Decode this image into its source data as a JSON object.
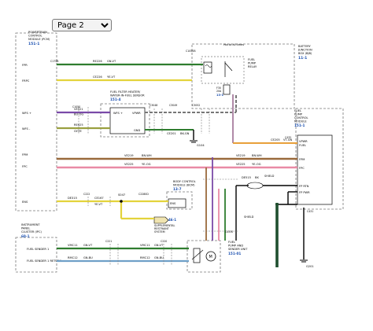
{
  "toolbar": {
    "page_select": {
      "options": [
        "Page 2"
      ],
      "selected": "Page 2"
    }
  },
  "diagram": {
    "pcm": {
      "title_lines": [
        "POWERTRAIN",
        "CONTROL",
        "MODULE (PCM)"
      ],
      "ref": "151-1"
    },
    "bjb": {
      "title_lines": [
        "BATTERY",
        "JUNCTION",
        "BOX (BJB)"
      ],
      "ref": "11-1"
    },
    "relay": {
      "title_lines": [
        "FUEL",
        "PUMP",
        "RELAY"
      ],
      "note": "Hot at all times"
    },
    "fuse": {
      "id": "F30",
      "amp": "20A",
      "ref": "13-1"
    },
    "filter": {
      "title_lines": [
        "FUEL FILTER HEATER/",
        "WATER-IN-FUEL SENSOR"
      ],
      "ref": "151-4",
      "pins": [
        "WFS +",
        "GND",
        "VPWR"
      ]
    },
    "fpcm": {
      "title_lines": [
        "FUEL",
        "PUMP",
        "CONTROL",
        "MODULE"
      ],
      "ref": "151-1",
      "pins": [
        "VPWR",
        "FUEL",
        "FPM",
        "FPC",
        "FP RTN",
        "FP PWR"
      ]
    },
    "bcm": {
      "title_lines": [
        "BODY CONTROL",
        "MODULE (BCM)"
      ],
      "ref": "13-7",
      "pin": "ENS"
    },
    "srs": {
      "ref": "46-1",
      "title_lines": [
        "SUPPLEMENTAL",
        "RESTRAINT",
        "SYSTEM"
      ]
    },
    "ipc": {
      "title_lines": [
        "INSTRUMENT",
        "PANEL",
        "CLUSTER (IPC)"
      ],
      "ref": "60-1"
    },
    "sender": {
      "title_lines": [
        "FUEL",
        "PUMP AND",
        "SENDER UNIT"
      ],
      "ref": "151-01"
    },
    "pcm_pins": [
      "FPR",
      "FRPC",
      "WFS +",
      "WFS -",
      "FPM",
      "FPC",
      "ENS"
    ],
    "ipc_pins": [
      "FUEL SENDER 1",
      "FUEL SENDER 1 RETURN"
    ],
    "grounds": [
      "G104",
      "G201"
    ],
    "shield": "SHIELD",
    "wires": [
      {
        "circuit": "CE226",
        "color": "YE-VT"
      },
      {
        "circuit": "RE226",
        "color": "GN-VT"
      },
      {
        "circuit": "VE021",
        "color": "BU-OG"
      },
      {
        "circuit": "RE025",
        "color": "GY-YE"
      },
      {
        "circuit": "VE219",
        "color": "BN-WH"
      },
      {
        "circuit": "VE225",
        "color": "YE-OG"
      },
      {
        "circuit": "CE201",
        "color": "BK-GN"
      },
      {
        "circuit": "CE005",
        "color": "YE-VT"
      },
      {
        "circuit": "VMC11",
        "color": "GN-VT"
      },
      {
        "circuit": "RMC12",
        "color": "GN-BU"
      },
      {
        "circuit": "CE167",
        "color": "YE-VT"
      },
      {
        "circuit": "CE205",
        "color": "VT-GN"
      },
      {
        "circuit": "DE315",
        "color": "BK"
      },
      {
        "circuit": "DE515",
        "color": "BK"
      },
      {
        "circuit": "SBB30",
        "color": "BK"
      }
    ],
    "connectors": [
      "C1050",
      "C1051",
      "C3048",
      "C3049",
      "C3052",
      "C3053",
      "C222",
      "C220",
      "S047",
      "C2280D",
      "C432",
      "C431",
      "C431",
      "C4330",
      "C4330",
      "C221",
      "C220",
      "C1050B",
      "C175B"
    ],
    "colors": {
      "yellow": "#e3d33c",
      "green": "#2f7d2f",
      "purple": "#7a4aa8",
      "orange": "#e8a03a",
      "brown": "#9a6a3c",
      "pink": "#e98aa5",
      "black": "#000000",
      "dash": "#777777"
    }
  }
}
